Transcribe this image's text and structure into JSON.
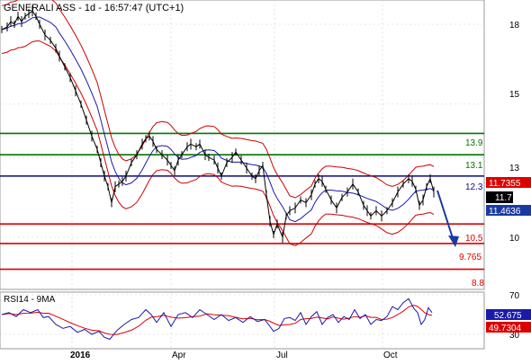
{
  "chart": {
    "title": "GENERALI ASS - 1d - 16:57:47 (UTC+1)",
    "rsi_title": "RSI14 - 9MA"
  },
  "colors": {
    "price": "#000000",
    "bollinger": "#cc0000",
    "ma": "#1a1aaa",
    "green_level": "#007700",
    "blue_level": "#0a0a80",
    "red_level": "#dd0000",
    "arrow": "#1a3aa0",
    "rsi": "#1a1aaa",
    "rsi_ma": "#dd0000",
    "last_price_bg": "#000000",
    "upper_band_bg": "#dd0000",
    "ma_bg": "#1a3aa0",
    "rsi_bg": "#1a1aaa",
    "rsi_ma_bg": "#dd0000",
    "grid": "#d0d0d0"
  },
  "chart_data": {
    "type": "line",
    "title": "GENERALI ASS - 1d - 16:57:47 (UTC+1)",
    "y_ticks": [
      "18",
      "15",
      "13",
      "10"
    ],
    "x_ticks": [
      "2016",
      "Apr",
      "Jul",
      "Oct"
    ],
    "rsi_ticks": [
      "70",
      "30"
    ],
    "levels": [
      {
        "label": "13.9",
        "value": 13.9,
        "color": "green"
      },
      {
        "label": "13.1",
        "value": 13.1,
        "color": "green"
      },
      {
        "label": "12.3",
        "value": 12.3,
        "color": "blue"
      },
      {
        "label": "10.5",
        "value": 10.5,
        "color": "red"
      },
      {
        "label": "9.765",
        "value": 9.765,
        "color": "red"
      },
      {
        "label": "8.8",
        "value": 8.8,
        "color": "red"
      }
    ],
    "tags": {
      "upper_band": "11.7355",
      "last_price": "11.7",
      "moving_average": "11.4636",
      "rsi": "52.675",
      "rsi_ma": "49.7304"
    },
    "price_points": [
      [
        0,
        17.8
      ],
      [
        6,
        17.9
      ],
      [
        10,
        18.1
      ],
      [
        14,
        18.0
      ],
      [
        18,
        18.3
      ],
      [
        22,
        18.1
      ],
      [
        26,
        18.3
      ],
      [
        30,
        18.4
      ],
      [
        34,
        18.5
      ],
      [
        38,
        18.3
      ],
      [
        42,
        18.0
      ],
      [
        48,
        17.6
      ],
      [
        54,
        17.4
      ],
      [
        60,
        17.1
      ],
      [
        64,
        16.8
      ],
      [
        70,
        16.4
      ],
      [
        76,
        16.0
      ],
      [
        82,
        15.5
      ],
      [
        88,
        15.0
      ],
      [
        94,
        14.4
      ],
      [
        100,
        13.8
      ],
      [
        106,
        13.3
      ],
      [
        110,
        12.8
      ],
      [
        114,
        12.3
      ],
      [
        118,
        11.9
      ],
      [
        122,
        11.3
      ],
      [
        126,
        11.9
      ],
      [
        130,
        12.0
      ],
      [
        134,
        12.1
      ],
      [
        138,
        12.3
      ],
      [
        144,
        12.8
      ],
      [
        150,
        13.1
      ],
      [
        156,
        13.5
      ],
      [
        160,
        13.7
      ],
      [
        164,
        13.8
      ],
      [
        168,
        13.6
      ],
      [
        172,
        13.3
      ],
      [
        178,
        13.1
      ],
      [
        184,
        12.9
      ],
      [
        188,
        12.7
      ],
      [
        192,
        12.5
      ],
      [
        196,
        12.9
      ],
      [
        200,
        13.1
      ],
      [
        206,
        13.4
      ],
      [
        210,
        13.5
      ],
      [
        216,
        13.4
      ],
      [
        220,
        13.5
      ],
      [
        226,
        13.1
      ],
      [
        230,
        13.0
      ],
      [
        236,
        12.9
      ],
      [
        240,
        12.6
      ],
      [
        244,
        12.3
      ],
      [
        250,
        12.8
      ],
      [
        256,
        13.0
      ],
      [
        260,
        13.2
      ],
      [
        266,
        12.9
      ],
      [
        272,
        12.6
      ],
      [
        278,
        12.3
      ],
      [
        282,
        12.2
      ],
      [
        286,
        12.5
      ],
      [
        290,
        12.7
      ],
      [
        294,
        11.6
      ],
      [
        298,
        10.6
      ],
      [
        302,
        10.1
      ],
      [
        306,
        10.5
      ],
      [
        312,
        10.0
      ],
      [
        316,
        10.8
      ],
      [
        320,
        11.0
      ],
      [
        326,
        11.1
      ],
      [
        332,
        11.4
      ],
      [
        338,
        11.3
      ],
      [
        344,
        11.6
      ],
      [
        348,
        12.0
      ],
      [
        352,
        12.2
      ],
      [
        356,
        12.1
      ],
      [
        360,
        11.8
      ],
      [
        366,
        11.4
      ],
      [
        372,
        11.1
      ],
      [
        378,
        11.5
      ],
      [
        384,
        11.7
      ],
      [
        390,
        12.0
      ],
      [
        396,
        11.7
      ],
      [
        402,
        11.2
      ],
      [
        406,
        11.0
      ],
      [
        410,
        10.8
      ],
      [
        416,
        11.0
      ],
      [
        422,
        10.8
      ],
      [
        428,
        11.0
      ],
      [
        434,
        11.3
      ],
      [
        440,
        11.7
      ],
      [
        446,
        12.0
      ],
      [
        452,
        12.2
      ],
      [
        456,
        12.1
      ],
      [
        460,
        11.8
      ],
      [
        464,
        11.2
      ],
      [
        468,
        11.4
      ],
      [
        472,
        11.9
      ],
      [
        476,
        12.2
      ],
      [
        480,
        11.7
      ]
    ],
    "rsi_points": [
      [
        0,
        50
      ],
      [
        8,
        52
      ],
      [
        16,
        48
      ],
      [
        24,
        55
      ],
      [
        32,
        52
      ],
      [
        40,
        55
      ],
      [
        46,
        47
      ],
      [
        52,
        48
      ],
      [
        60,
        40
      ],
      [
        68,
        36
      ],
      [
        76,
        38
      ],
      [
        84,
        32
      ],
      [
        92,
        35
      ],
      [
        100,
        30
      ],
      [
        108,
        33
      ],
      [
        114,
        27
      ],
      [
        120,
        25
      ],
      [
        128,
        34
      ],
      [
        136,
        40
      ],
      [
        144,
        45
      ],
      [
        152,
        47
      ],
      [
        160,
        55
      ],
      [
        166,
        50
      ],
      [
        172,
        42
      ],
      [
        180,
        52
      ],
      [
        188,
        38
      ],
      [
        196,
        50
      ],
      [
        204,
        52
      ],
      [
        212,
        47
      ],
      [
        220,
        55
      ],
      [
        228,
        50
      ],
      [
        236,
        45
      ],
      [
        244,
        50
      ],
      [
        252,
        44
      ],
      [
        260,
        47
      ],
      [
        268,
        42
      ],
      [
        276,
        48
      ],
      [
        284,
        43
      ],
      [
        292,
        45
      ],
      [
        298,
        38
      ],
      [
        302,
        33
      ],
      [
        308,
        36
      ],
      [
        314,
        46
      ],
      [
        320,
        47
      ],
      [
        326,
        44
      ],
      [
        332,
        52
      ],
      [
        338,
        40
      ],
      [
        344,
        48
      ],
      [
        350,
        53
      ],
      [
        356,
        40
      ],
      [
        362,
        47
      ],
      [
        368,
        50
      ],
      [
        374,
        42
      ],
      [
        380,
        48
      ],
      [
        386,
        45
      ],
      [
        392,
        55
      ],
      [
        398,
        46
      ],
      [
        404,
        50
      ],
      [
        410,
        40
      ],
      [
        416,
        45
      ],
      [
        422,
        44
      ],
      [
        428,
        48
      ],
      [
        434,
        58
      ],
      [
        440,
        55
      ],
      [
        446,
        62
      ],
      [
        452,
        66
      ],
      [
        458,
        56
      ],
      [
        462,
        52
      ],
      [
        466,
        40
      ],
      [
        470,
        45
      ],
      [
        474,
        57
      ],
      [
        478,
        52
      ]
    ]
  }
}
